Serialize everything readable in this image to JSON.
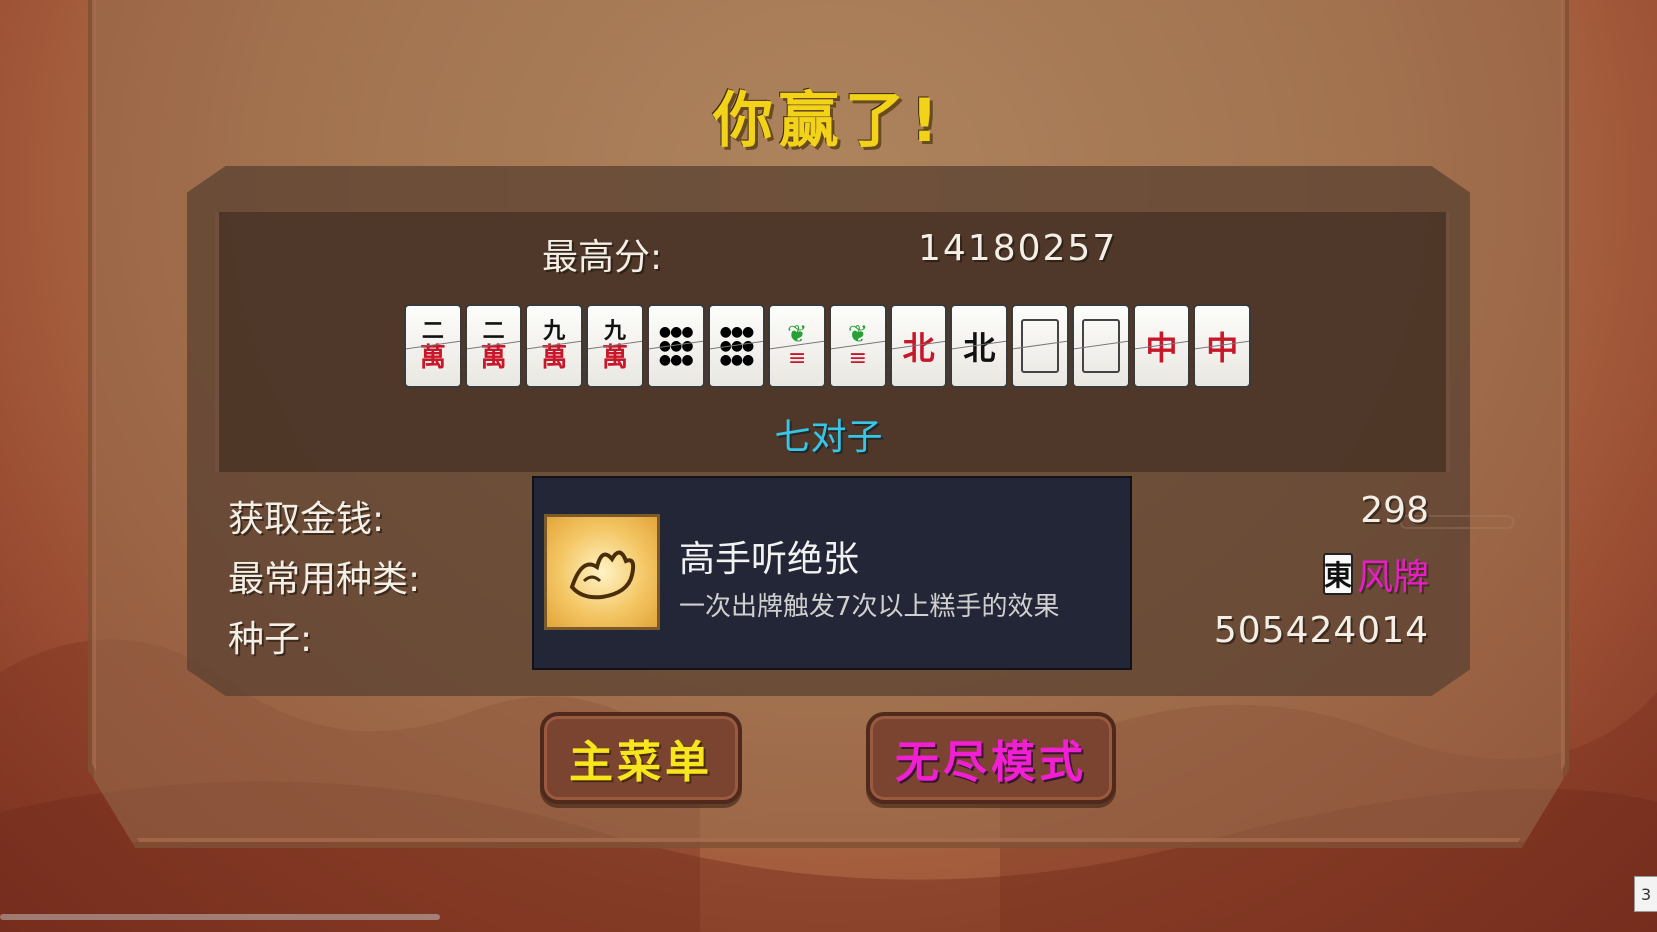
{
  "title": "你赢了!",
  "high_score": {
    "label": "最高分:",
    "value": "14180257"
  },
  "hand": {
    "tiles": [
      {
        "name": "tile-2-character",
        "top": "二",
        "bottom": "萬",
        "kind": "character"
      },
      {
        "name": "tile-2-character",
        "top": "二",
        "bottom": "萬",
        "kind": "character"
      },
      {
        "name": "tile-9-character",
        "top": "九",
        "bottom": "萬",
        "kind": "character"
      },
      {
        "name": "tile-9-character",
        "top": "九",
        "bottom": "萬",
        "kind": "character"
      },
      {
        "name": "tile-9-dots",
        "top": "",
        "bottom": "",
        "kind": "dots"
      },
      {
        "name": "tile-9-dots",
        "top": "",
        "bottom": "",
        "kind": "dots"
      },
      {
        "name": "tile-1-bamboo",
        "top": "",
        "bottom": "",
        "kind": "bamboo"
      },
      {
        "name": "tile-1-bamboo",
        "top": "",
        "bottom": "",
        "kind": "bamboo"
      },
      {
        "name": "tile-north-wind",
        "top": "",
        "bottom": "北",
        "kind": "wind-red"
      },
      {
        "name": "tile-north-wind",
        "top": "",
        "bottom": "北",
        "kind": "wind"
      },
      {
        "name": "tile-white-dragon",
        "top": "",
        "bottom": "",
        "kind": "blank"
      },
      {
        "name": "tile-white-dragon",
        "top": "",
        "bottom": "",
        "kind": "blank"
      },
      {
        "name": "tile-red-dragon",
        "top": "",
        "bottom": "中",
        "kind": "red"
      },
      {
        "name": "tile-red-dragon",
        "top": "",
        "bottom": "中",
        "kind": "red"
      }
    ],
    "yaku": "七对子"
  },
  "stats": {
    "money_label": "获取金钱:",
    "money_value": "298",
    "category_label": "最常用种类:",
    "category_tile": "東",
    "category_value": "风牌",
    "seed_label": "种子:",
    "seed_value": "505424014"
  },
  "tooltip": {
    "icon": "hand-icon",
    "title": "高手听绝张",
    "description": "一次出牌触发7次以上糕手的效果"
  },
  "buttons": {
    "main_menu": "主菜单",
    "endless_mode": "无尽模式"
  },
  "corner_badge": "3",
  "colors": {
    "title": "#f3d21a",
    "yaku": "#38c6e6",
    "main_menu": "#f7e61c",
    "endless_mode": "#f01fd2",
    "category": "#e51ec5"
  }
}
